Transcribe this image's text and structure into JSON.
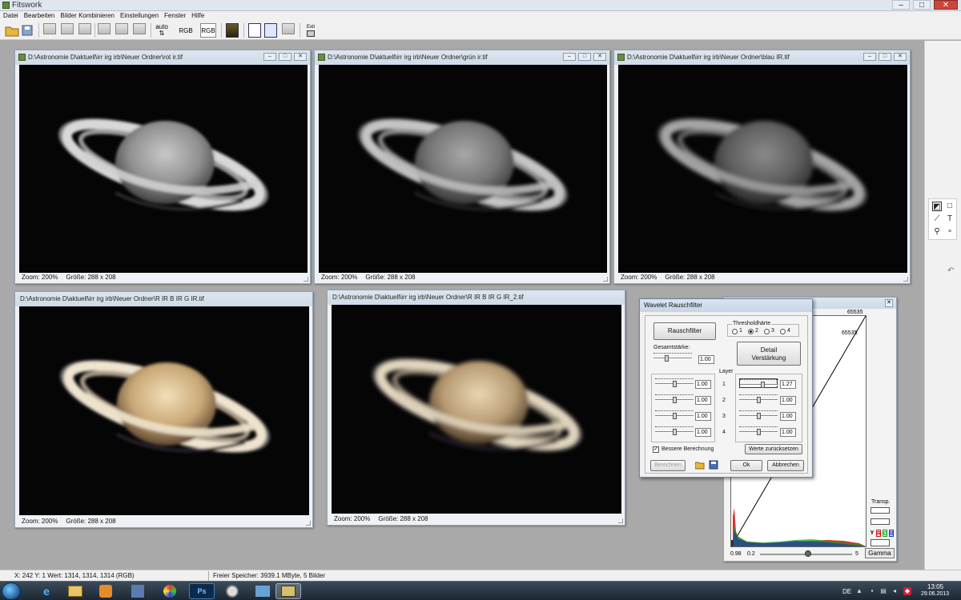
{
  "app": {
    "title": "Fitswork",
    "window_controls": [
      "–",
      "□",
      "✕"
    ]
  },
  "menubar": {
    "items": [
      "Datei",
      "Bearbeiten",
      "Bilder Kombinieren",
      "Einstellungen",
      "Fenster",
      "Hilfe"
    ]
  },
  "toolbar": {
    "auto_label": "auto",
    "auto_sub": "⇅",
    "rgb1_label": "RGB",
    "rgb2_label": "RGB",
    "exit_label": "Exit"
  },
  "image_windows": [
    {
      "title": "D:\\Astronomie D\\aktuell\\irr irg irb\\Neuer Ordner\\rot ir.tif",
      "zoom": "Zoom: 200%",
      "size": "Größe: 288 x 208",
      "tint": "gray"
    },
    {
      "title": "D:\\Astronomie D\\aktuell\\irr irg irb\\Neuer Ordner\\grün ir.tif",
      "zoom": "Zoom: 200%",
      "size": "Größe: 288 x 208",
      "tint": "gray"
    },
    {
      "title": "D:\\Astronomie D\\aktuell\\irr irg irb\\Neuer Ordner\\blau IR.tif",
      "zoom": "Zoom: 200%",
      "size": "Größe: 288 x 208",
      "tint": "gray"
    },
    {
      "title": "D:\\Astronomie D\\aktuell\\irr irg irb\\Neuer Ordner\\R IR B IR G IR.tif",
      "zoom": "Zoom: 200%",
      "size": "Größe: 288 x 208",
      "tint": "color"
    },
    {
      "title": "D:\\Astronomie D\\aktuell\\irr irg irb\\Neuer Ordner\\R IR B IR G IR_2.tif",
      "zoom": "Zoom: 200%",
      "size": "Größe: 288 x 208",
      "tint": "color"
    }
  ],
  "histogram": {
    "top_value": "65535",
    "top_value_2": "65535",
    "min_label": "0.98",
    "slider_min": "0.2",
    "slider_max": "5",
    "transp_label": "Transp.",
    "channel_y": "Y",
    "channel_r": "R",
    "channel_g": "G",
    "channel_b": "B",
    "gamma_button": "Gamma",
    "gamma_level": 0.52,
    "colors": {
      "red": "#d01010",
      "green": "#10a010",
      "blue": "#1030d0"
    }
  },
  "wavelet": {
    "title": "Wavelet Rauschfilter",
    "rauschfilter_button": "Rauschfilter",
    "threshold_group": "Thresholdhärte",
    "threshold_options": [
      "1",
      "2",
      "3",
      "4"
    ],
    "threshold_selected": "2",
    "gesamtstaerke_label": "Gesamtstärke:",
    "gesamtstaerke_value": "1.00",
    "detail_button_line1": "Detail",
    "detail_button_line2": "Verstärkung",
    "layer_label": "Layer",
    "layers": [
      {
        "num": "1",
        "noise": "1.00",
        "detail": "1.27"
      },
      {
        "num": "2",
        "noise": "1.00",
        "detail": "1.00"
      },
      {
        "num": "3",
        "noise": "1.00",
        "detail": "1.00"
      },
      {
        "num": "4",
        "noise": "1.00",
        "detail": "1.00"
      }
    ],
    "bessere_label": "Bessere Berechnung",
    "bessere_checked": true,
    "reset_button": "Werte zurücksetzen",
    "berechnen_button": "Berechnen",
    "ok_button": "Ok",
    "cancel_button": "Abbrechen"
  },
  "statusbar": {
    "coords": "X: 242  Y: 1  Wert: 1314, 1314, 1314 (RGB)",
    "memory": "Freier Speicher: 3939.1 MByte, 5 Bilder"
  },
  "taskbar": {
    "lang": "DE",
    "time": "13:05",
    "date": "29.06.2013",
    "ps_label": "Ps"
  }
}
